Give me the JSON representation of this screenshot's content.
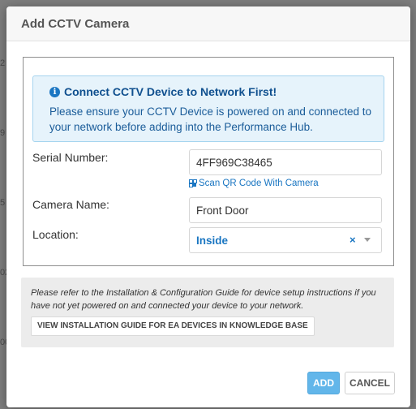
{
  "background": {
    "numbers": [
      "2",
      "9",
      "5",
      "02",
      "00"
    ]
  },
  "modal": {
    "title": "Add CCTV Camera",
    "alert": {
      "icon": "info-icon",
      "title": "Connect CCTV Device to Network First!",
      "body": "Please ensure your CCTV Device is powered on and connected to your network before adding into the Performance Hub."
    },
    "form": {
      "serial_label": "Serial Number:",
      "serial_value": "4FF969C38465",
      "scan_link": "Scan QR Code With Camera",
      "camera_name_label": "Camera Name:",
      "camera_name_value": "Front Door",
      "location_label": "Location:",
      "location_value": "Inside",
      "location_clear": "×"
    },
    "guide": {
      "text": "Please refer to the Installation & Configuration Guide for device setup instructions if you have not yet powered on and connected your device to your network.",
      "button": "VIEW INSTALLATION GUIDE FOR EA DEVICES IN KNOWLEDGE BASE"
    },
    "buttons": {
      "add": "ADD",
      "cancel": "CANCEL"
    }
  },
  "colors": {
    "accent": "#1a76c2",
    "alert_bg": "#e6f3fb",
    "add_button": "#62b6ea"
  }
}
